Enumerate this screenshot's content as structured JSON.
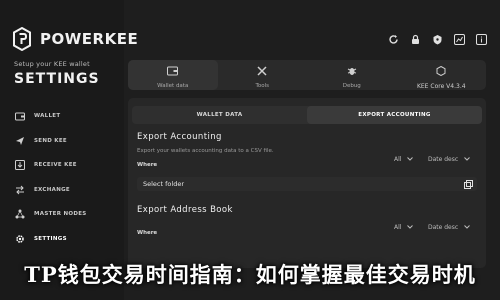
{
  "brand": {
    "name": "POWERKEE"
  },
  "sidebar": {
    "setup_text": "Setup your KEE wallet",
    "title": "SETTINGS",
    "items": [
      {
        "label": "WALLET",
        "icon": "wallet-icon"
      },
      {
        "label": "SEND KEE",
        "icon": "send-icon"
      },
      {
        "label": "RECEIVE KEE",
        "icon": "receive-icon"
      },
      {
        "label": "EXCHANGE",
        "icon": "exchange-icon"
      },
      {
        "label": "MASTER NODES",
        "icon": "nodes-icon"
      },
      {
        "label": "SETTINGS",
        "icon": "gear-icon",
        "active": true
      }
    ]
  },
  "toolbar": {
    "icons": [
      "refresh-icon",
      "lock-icon",
      "security-icon",
      "chart-icon",
      "info-icon"
    ]
  },
  "tabs": [
    {
      "label": "Wallet data",
      "icon": "wallet-data-icon",
      "active": true
    },
    {
      "label": "Tools",
      "icon": "tools-icon"
    },
    {
      "label": "Debug",
      "icon": "debug-icon"
    },
    {
      "label": "KEE Core V4.3.4",
      "icon": "kee-core-icon"
    }
  ],
  "subtabs": [
    {
      "label": "WALLET DATA"
    },
    {
      "label": "EXPORT ACCOUNTING",
      "active": true
    }
  ],
  "export_accounting": {
    "title": "Export Accounting",
    "description": "Export your wallets accounting data to a CSV file.",
    "where_label": "Where",
    "filter_value": "All",
    "sort_value": "Date desc",
    "folder_value": "Select folder"
  },
  "export_address_book": {
    "title": "Export Address Book",
    "where_label": "Where",
    "filter_value": "All",
    "sort_value": "Date desc"
  },
  "banner": {
    "text": "TP钱包交易时间指南：如何掌握最佳交易时机"
  },
  "colors": {
    "background": "#1e1e1e",
    "panel": "#272727",
    "text": "#e6e6e6"
  }
}
